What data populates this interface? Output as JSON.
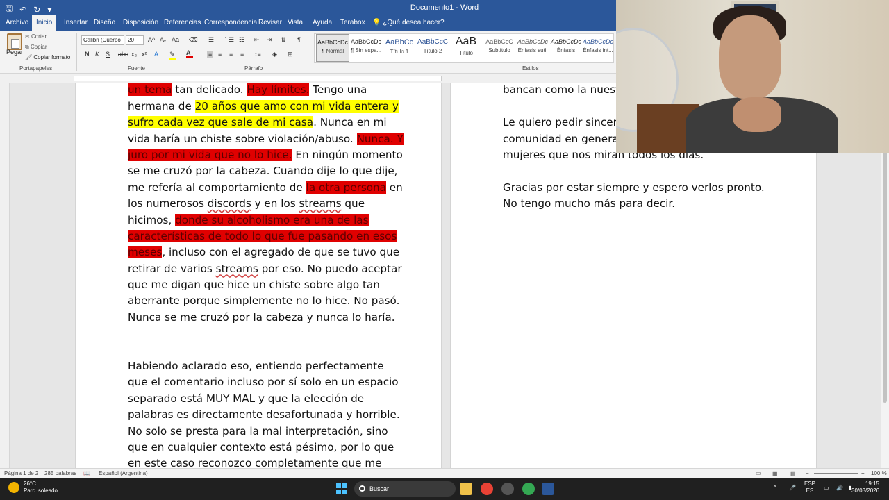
{
  "window": {
    "title": "Documento1 - Word"
  },
  "tabs": [
    {
      "label": "Archivo"
    },
    {
      "label": "Inicio"
    },
    {
      "label": "Insertar"
    },
    {
      "label": "Diseño"
    },
    {
      "label": "Disposición"
    },
    {
      "label": "Referencias"
    },
    {
      "label": "Correspondencia"
    },
    {
      "label": "Revisar"
    },
    {
      "label": "Vista"
    },
    {
      "label": "Ayuda"
    },
    {
      "label": "Terabox"
    }
  ],
  "tell_me": "¿Qué desea hacer?",
  "clipboard": {
    "paste": "Pegar",
    "cut": "Cortar",
    "copy": "Copiar",
    "format_painter": "Copiar formato",
    "group": "Portapapeles"
  },
  "font": {
    "name": "Calibri (Cuerpo",
    "size": "20",
    "group": "Fuente",
    "bold": "N",
    "italic": "K",
    "underline": "S",
    "strike": "abc",
    "sub": "x₂",
    "sup": "x²",
    "grow": "A^",
    "shrink": "Aᵥ",
    "case": "Aa",
    "highlight_color": "#ffff00",
    "font_color": "#e00000"
  },
  "paragraph": {
    "group": "Párrafo"
  },
  "styles": {
    "group": "Estilos",
    "items": [
      {
        "preview": "AaBbCcDc",
        "name": "¶ Normal"
      },
      {
        "preview": "AaBbCcDc",
        "name": "¶ Sin espa..."
      },
      {
        "preview": "AaBbCc",
        "name": "Título 1"
      },
      {
        "preview": "AaBbCcC",
        "name": "Título 2"
      },
      {
        "preview": "AaB",
        "name": "Título"
      },
      {
        "preview": "AaBbCcC",
        "name": "Subtítulo"
      },
      {
        "preview": "AaBbCcDc",
        "name": "Énfasis sutil"
      },
      {
        "preview": "AaBbCcDc",
        "name": "Énfasis"
      },
      {
        "preview": "AaBbCcDc",
        "name": "Énfasis int..."
      }
    ]
  },
  "page1": {
    "lines": [
      [
        {
          "t": "jamás en mi vida se me ocurriría hacer un chiste con",
          "h": "red"
        }
      ],
      [
        {
          "t": "un tema",
          "h": "red"
        },
        {
          "t": " tan delicado. "
        },
        {
          "t": "Hay límites.",
          "h": "red"
        },
        {
          "t": " Tengo una"
        }
      ],
      [
        {
          "t": "hermana de "
        },
        {
          "t": "20 años que amo con mi vida entera y",
          "h": "yel"
        }
      ],
      [
        {
          "t": "sufro cada vez que sale de mi casa",
          "h": "yel"
        },
        {
          "t": ". Nunca en mi"
        }
      ],
      [
        {
          "t": "vida haría un chiste sobre violación/abuso. "
        },
        {
          "t": "Nunca. Y",
          "h": "red"
        }
      ],
      [
        {
          "t": "juro por mi vida que no lo hice.",
          "h": "red"
        },
        {
          "t": " En ningún momento"
        }
      ],
      [
        {
          "t": "se me cruzó por la cabeza. Cuando dije lo que dije,"
        }
      ],
      [
        {
          "t": "me refería al comportamiento de "
        },
        {
          "t": "la otra persona",
          "h": "red"
        },
        {
          "t": " en"
        }
      ],
      [
        {
          "t": "los numerosos "
        },
        {
          "t": "discords",
          "u": 1
        },
        {
          "t": " y en los "
        },
        {
          "t": "streams",
          "u": 1
        },
        {
          "t": " que"
        }
      ],
      [
        {
          "t": "hicimos, "
        },
        {
          "t": "donde su alcoholismo era una de las",
          "h": "red"
        }
      ],
      [
        {
          "t": "características de todo lo que fue pasando en esos",
          "h": "red"
        }
      ],
      [
        {
          "t": "meses",
          "h": "red"
        },
        {
          "t": ", incluso con el agregado de que se tuvo que"
        }
      ],
      [
        {
          "t": "retirar de varios "
        },
        {
          "t": "streams",
          "u": 1
        },
        {
          "t": " por eso. No puedo aceptar"
        }
      ],
      [
        {
          "t": "que me digan que hice un chiste sobre algo tan"
        }
      ],
      [
        {
          "t": "aberrante porque simplemente no lo hice. No pasó."
        }
      ],
      [
        {
          "t": "Nunca se me cruzó por la cabeza y nunca lo haría."
        }
      ],
      [
        {
          "t": ""
        }
      ],
      [
        {
          "t": ""
        }
      ],
      [
        {
          "t": "Habiendo aclarado eso, entiendo perfectamente"
        }
      ],
      [
        {
          "t": "que el comentario incluso por sí solo en un espacio"
        }
      ],
      [
        {
          "t": "separado está MUY MAL y que la elección de"
        }
      ],
      [
        {
          "t": "palabras es directamente desafortunada y horrible."
        }
      ],
      [
        {
          "t": "No solo se presta para la mal interpretación, sino"
        }
      ],
      [
        {
          "t": "que en cualquier contexto está pésimo, por lo que"
        }
      ],
      [
        {
          "t": "en este caso reconozco completamente que me"
        }
      ]
    ]
  },
  "page2": {
    "lines": [
      [
        {
          "t": "comunidad con tantas"
        }
      ],
      [
        {
          "t": "bancan como la nuestr"
        }
      ],
      [
        {
          "t": ""
        }
      ],
      [
        {
          "t": "Le quiero pedir sincera"
        }
      ],
      [
        {
          "t": "comunidad en general y especialmente a todas las"
        }
      ],
      [
        {
          "t": "mujeres que nos miran todos los días."
        }
      ],
      [
        {
          "t": ""
        }
      ],
      [
        {
          "t": "Gracias por estar siempre y espero verlos pronto."
        }
      ],
      [
        {
          "t": "No tengo mucho más para decir."
        }
      ]
    ]
  },
  "status": {
    "page": "Página 1 de 2",
    "words": "285 palabras",
    "language": "Español (Argentina)",
    "zoom": "100 %"
  },
  "taskbar": {
    "weather_temp": "26°C",
    "weather_desc": "Parc. soleado",
    "search": "Buscar",
    "lang1": "ESP",
    "lang2": "ES",
    "time": "19:15",
    "date": "30/03/2026"
  }
}
